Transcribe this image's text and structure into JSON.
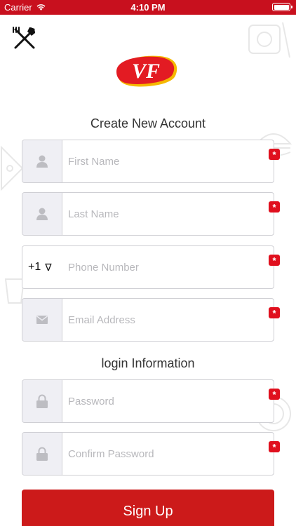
{
  "status_bar": {
    "carrier": "Carrier",
    "time": "4:10 PM",
    "background_color": "#c8101e"
  },
  "menu_icon": "fork-knife-icon",
  "logo": {
    "text": "VF",
    "color": "#e31b23",
    "accent": "#f5b800"
  },
  "create_account": {
    "title": "Create New Account",
    "fields": [
      {
        "placeholder": "First Name",
        "icon": "person-icon"
      },
      {
        "placeholder": "Last Name",
        "icon": "person-icon"
      },
      {
        "placeholder": "Phone Number",
        "country_code": "+1",
        "dropdown_symbol": "∇"
      },
      {
        "placeholder": "Email Address",
        "icon": "envelope-icon"
      }
    ]
  },
  "login_information": {
    "title": "login Information",
    "fields": [
      {
        "placeholder": "Password",
        "icon": "lock-icon"
      },
      {
        "placeholder": "Confirm Password",
        "icon": "lock-icon"
      }
    ]
  },
  "required_marker": "*",
  "signup_button": {
    "label": "Sign Up",
    "color": "#cc1a1a"
  }
}
